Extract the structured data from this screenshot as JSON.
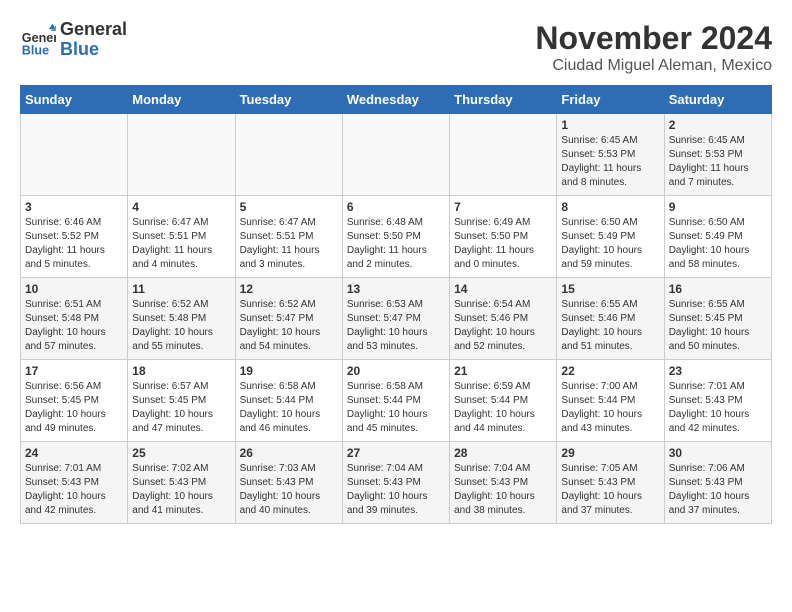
{
  "logo": {
    "general": "General",
    "blue": "Blue"
  },
  "title": "November 2024",
  "subtitle": "Ciudad Miguel Aleman, Mexico",
  "headers": [
    "Sunday",
    "Monday",
    "Tuesday",
    "Wednesday",
    "Thursday",
    "Friday",
    "Saturday"
  ],
  "weeks": [
    [
      {
        "day": "",
        "info": ""
      },
      {
        "day": "",
        "info": ""
      },
      {
        "day": "",
        "info": ""
      },
      {
        "day": "",
        "info": ""
      },
      {
        "day": "",
        "info": ""
      },
      {
        "day": "1",
        "info": "Sunrise: 6:45 AM\nSunset: 5:53 PM\nDaylight: 11 hours\nand 8 minutes."
      },
      {
        "day": "2",
        "info": "Sunrise: 6:45 AM\nSunset: 5:53 PM\nDaylight: 11 hours\nand 7 minutes."
      }
    ],
    [
      {
        "day": "3",
        "info": "Sunrise: 6:46 AM\nSunset: 5:52 PM\nDaylight: 11 hours\nand 5 minutes."
      },
      {
        "day": "4",
        "info": "Sunrise: 6:47 AM\nSunset: 5:51 PM\nDaylight: 11 hours\nand 4 minutes."
      },
      {
        "day": "5",
        "info": "Sunrise: 6:47 AM\nSunset: 5:51 PM\nDaylight: 11 hours\nand 3 minutes."
      },
      {
        "day": "6",
        "info": "Sunrise: 6:48 AM\nSunset: 5:50 PM\nDaylight: 11 hours\nand 2 minutes."
      },
      {
        "day": "7",
        "info": "Sunrise: 6:49 AM\nSunset: 5:50 PM\nDaylight: 11 hours\nand 0 minutes."
      },
      {
        "day": "8",
        "info": "Sunrise: 6:50 AM\nSunset: 5:49 PM\nDaylight: 10 hours\nand 59 minutes."
      },
      {
        "day": "9",
        "info": "Sunrise: 6:50 AM\nSunset: 5:49 PM\nDaylight: 10 hours\nand 58 minutes."
      }
    ],
    [
      {
        "day": "10",
        "info": "Sunrise: 6:51 AM\nSunset: 5:48 PM\nDaylight: 10 hours\nand 57 minutes."
      },
      {
        "day": "11",
        "info": "Sunrise: 6:52 AM\nSunset: 5:48 PM\nDaylight: 10 hours\nand 55 minutes."
      },
      {
        "day": "12",
        "info": "Sunrise: 6:52 AM\nSunset: 5:47 PM\nDaylight: 10 hours\nand 54 minutes."
      },
      {
        "day": "13",
        "info": "Sunrise: 6:53 AM\nSunset: 5:47 PM\nDaylight: 10 hours\nand 53 minutes."
      },
      {
        "day": "14",
        "info": "Sunrise: 6:54 AM\nSunset: 5:46 PM\nDaylight: 10 hours\nand 52 minutes."
      },
      {
        "day": "15",
        "info": "Sunrise: 6:55 AM\nSunset: 5:46 PM\nDaylight: 10 hours\nand 51 minutes."
      },
      {
        "day": "16",
        "info": "Sunrise: 6:55 AM\nSunset: 5:45 PM\nDaylight: 10 hours\nand 50 minutes."
      }
    ],
    [
      {
        "day": "17",
        "info": "Sunrise: 6:56 AM\nSunset: 5:45 PM\nDaylight: 10 hours\nand 49 minutes."
      },
      {
        "day": "18",
        "info": "Sunrise: 6:57 AM\nSunset: 5:45 PM\nDaylight: 10 hours\nand 47 minutes."
      },
      {
        "day": "19",
        "info": "Sunrise: 6:58 AM\nSunset: 5:44 PM\nDaylight: 10 hours\nand 46 minutes."
      },
      {
        "day": "20",
        "info": "Sunrise: 6:58 AM\nSunset: 5:44 PM\nDaylight: 10 hours\nand 45 minutes."
      },
      {
        "day": "21",
        "info": "Sunrise: 6:59 AM\nSunset: 5:44 PM\nDaylight: 10 hours\nand 44 minutes."
      },
      {
        "day": "22",
        "info": "Sunrise: 7:00 AM\nSunset: 5:44 PM\nDaylight: 10 hours\nand 43 minutes."
      },
      {
        "day": "23",
        "info": "Sunrise: 7:01 AM\nSunset: 5:43 PM\nDaylight: 10 hours\nand 42 minutes."
      }
    ],
    [
      {
        "day": "24",
        "info": "Sunrise: 7:01 AM\nSunset: 5:43 PM\nDaylight: 10 hours\nand 42 minutes."
      },
      {
        "day": "25",
        "info": "Sunrise: 7:02 AM\nSunset: 5:43 PM\nDaylight: 10 hours\nand 41 minutes."
      },
      {
        "day": "26",
        "info": "Sunrise: 7:03 AM\nSunset: 5:43 PM\nDaylight: 10 hours\nand 40 minutes."
      },
      {
        "day": "27",
        "info": "Sunrise: 7:04 AM\nSunset: 5:43 PM\nDaylight: 10 hours\nand 39 minutes."
      },
      {
        "day": "28",
        "info": "Sunrise: 7:04 AM\nSunset: 5:43 PM\nDaylight: 10 hours\nand 38 minutes."
      },
      {
        "day": "29",
        "info": "Sunrise: 7:05 AM\nSunset: 5:43 PM\nDaylight: 10 hours\nand 37 minutes."
      },
      {
        "day": "30",
        "info": "Sunrise: 7:06 AM\nSunset: 5:43 PM\nDaylight: 10 hours\nand 37 minutes."
      }
    ]
  ]
}
